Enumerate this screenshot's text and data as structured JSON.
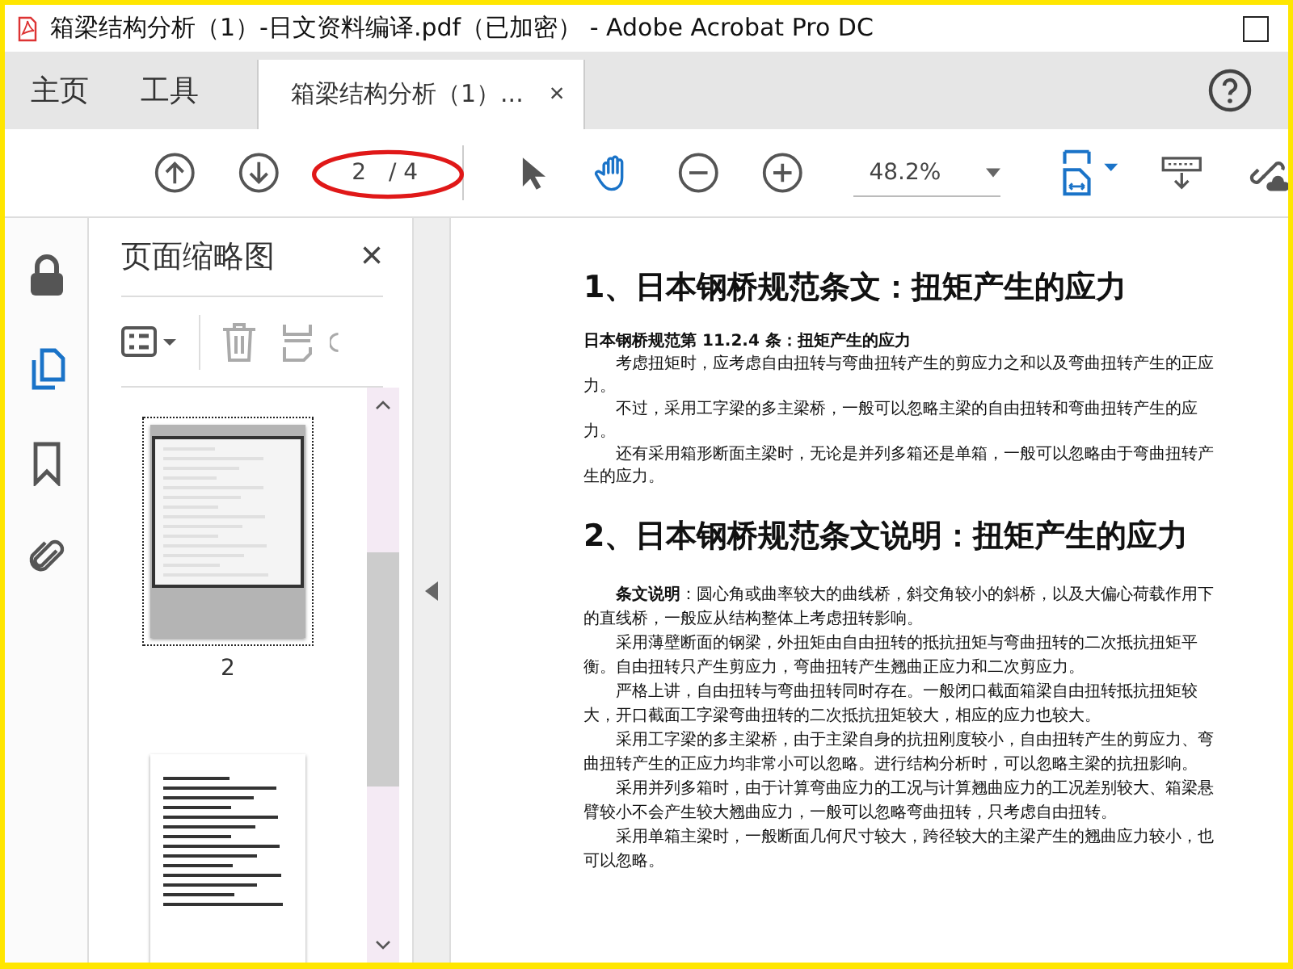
{
  "window": {
    "title": "箱梁结构分析（1）-日文资料编译.pdf（已加密） - Adobe Acrobat Pro DC"
  },
  "nav_tabs": [
    {
      "label": "主页",
      "selected": false
    },
    {
      "label": "工具",
      "selected": false
    }
  ],
  "document_tab": {
    "label": "箱梁结构分析（1）...",
    "close": "×",
    "selected": true
  },
  "toolbar": {
    "page_current": "2",
    "page_total": "/ 4",
    "zoom": "48.2%"
  },
  "thumbnail_panel": {
    "title": "页面缩略图",
    "close": "×",
    "thumbnails": [
      {
        "label": "2",
        "selected": true
      },
      {
        "selected": false
      }
    ]
  },
  "document": {
    "blocks": [
      {
        "kind": "heading",
        "text": "1、日本钢桥规范条文：扭矩产生的应力"
      },
      {
        "kind": "subheading",
        "text": "日本钢桥规范第 11.2.4 条：扭矩产生的应力"
      },
      {
        "kind": "paragraph",
        "text": "考虑扭矩时，应考虑自由扭转与弯曲扭转产生的剪应力之和以及弯曲扭转产生的正应力。"
      },
      {
        "kind": "paragraph",
        "text": "不过，采用工字梁的多主梁桥，一般可以忽略主梁的自由扭转和弯曲扭转产生的应力。"
      },
      {
        "kind": "paragraph",
        "text": "还有采用箱形断面主梁时，无论是并列多箱还是单箱，一般可以忽略由于弯曲扭转产生的应力。"
      },
      {
        "kind": "heading",
        "text": "2、日本钢桥规范条文说明：扭矩产生的应力"
      },
      {
        "kind": "lead",
        "label": "条文说明",
        "text": "：圆心角或曲率较大的曲线桥，斜交角较小的斜桥，以及大偏心荷载作用下的直线桥，一般应从结构整体上考虑扭转影响。"
      },
      {
        "kind": "paragraph",
        "text": "采用薄壁断面的钢梁，外扭矩由自由扭转的抵抗扭矩与弯曲扭转的二次抵抗扭矩平衡。自由扭转只产生剪应力，弯曲扭转产生翘曲正应力和二次剪应力。"
      },
      {
        "kind": "paragraph",
        "text": "严格上讲，自由扭转与弯曲扭转同时存在。一般闭口截面箱梁自由扭转抵抗扭矩较大，开口截面工字梁弯曲扭转的二次抵抗扭矩较大，相应的应力也较大。"
      },
      {
        "kind": "paragraph",
        "text": "采用工字梁的多主梁桥，由于主梁自身的抗扭刚度较小，自由扭转产生的剪应力、弯曲扭转产生的正应力均非常小可以忽略。进行结构分析时，可以忽略主梁的抗扭影响。"
      },
      {
        "kind": "paragraph",
        "text": "采用并列多箱时，由于计算弯曲应力的工况与计算翘曲应力的工况差别较大、箱梁悬臂较小不会产生较大翘曲应力，一般可以忽略弯曲扭转，只考虑自由扭转。"
      },
      {
        "kind": "paragraph",
        "text": "采用单箱主梁时，一般断面几何尺寸较大，跨径较大的主梁产生的翘曲应力较小，也可以忽略。"
      }
    ]
  }
}
